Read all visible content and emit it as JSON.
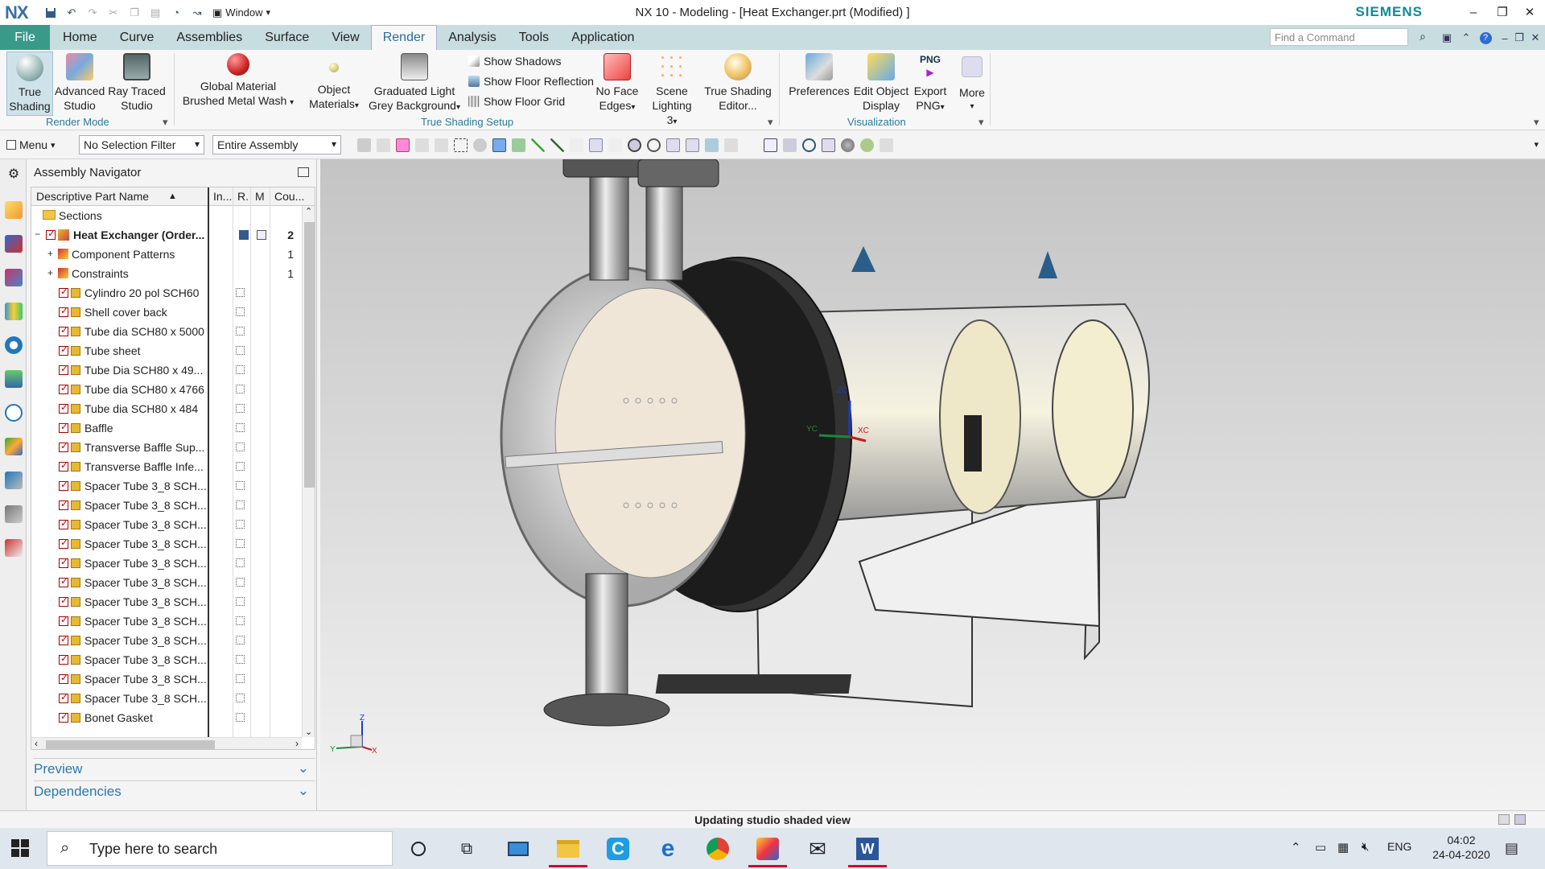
{
  "titlebar": {
    "app_logo": "NX",
    "window_menu": "Window",
    "title": "NX 10 - Modeling - [Heat Exchanger.prt (Modified) ]",
    "brand": "SIEMENS",
    "icons": [
      "save-icon",
      "undo-icon",
      "redo-icon",
      "cut-icon",
      "copy-icon",
      "paste-icon",
      "repeat-command-icon",
      "window-icon"
    ]
  },
  "tabs": {
    "file": "File",
    "items": [
      "Home",
      "Curve",
      "Assemblies",
      "Surface",
      "View",
      "Render",
      "Analysis",
      "Tools",
      "Application"
    ],
    "active": "Render",
    "find_placeholder": "Find a Command"
  },
  "ribbon": {
    "render_mode": {
      "label": "Render Mode",
      "true_shading": [
        "True",
        "Shading"
      ],
      "advanced_studio": [
        "Advanced",
        "Studio"
      ],
      "ray_traced_studio": [
        "Ray Traced",
        "Studio"
      ]
    },
    "true_shading_setup": {
      "label": "True Shading Setup",
      "global_material": [
        "Global Material",
        "Brushed Metal Wash"
      ],
      "object_materials": [
        "Object",
        "Materials"
      ],
      "graduated_light": [
        "Graduated Light",
        "Grey Background"
      ],
      "show_shadows": "Show Shadows",
      "show_floor_reflection": "Show Floor Reflection",
      "show_floor_grid": "Show Floor Grid",
      "no_face_edges": [
        "No Face",
        "Edges"
      ],
      "scene_lighting": [
        "Scene",
        "Lighting 3"
      ],
      "true_shading_editor": [
        "True Shading",
        "Editor..."
      ]
    },
    "visualization": {
      "label": "Visualization",
      "preferences": "Preferences",
      "edit_object_display": [
        "Edit Object",
        "Display"
      ],
      "export_png": [
        "Export",
        "PNG"
      ],
      "export_png_icon_text": "PNG",
      "more": "More"
    }
  },
  "toolbar": {
    "menu": "Menu",
    "selection_filter": "No Selection Filter",
    "scope": "Entire Assembly"
  },
  "navigator": {
    "title": "Assembly Navigator",
    "columns": [
      "Descriptive Part Name",
      "In...",
      "R.",
      "M",
      "Cou..."
    ],
    "rows": [
      {
        "name": "Sections",
        "type": "folder",
        "level": 0
      },
      {
        "name": "Heat Exchanger (Order...",
        "type": "assembly",
        "level": 0,
        "bold": true,
        "count": "2"
      },
      {
        "name": "Component Patterns",
        "type": "patterns",
        "level": 1,
        "count": "1"
      },
      {
        "name": "Constraints",
        "type": "constraints",
        "level": 1,
        "count": "1"
      },
      {
        "name": "Cylindro 20 pol SCH60",
        "type": "part",
        "level": 2
      },
      {
        "name": "Shell cover back",
        "type": "part",
        "level": 2
      },
      {
        "name": "Tube dia SCH80 x 5000",
        "type": "part",
        "level": 2
      },
      {
        "name": "Tube sheet",
        "type": "part",
        "level": 2
      },
      {
        "name": "Tube Dia SCH80 x 49...",
        "type": "part",
        "level": 2
      },
      {
        "name": "Tube dia SCH80 x 4766",
        "type": "part",
        "level": 2
      },
      {
        "name": "Tube dia SCH80 x 484",
        "type": "part",
        "level": 2
      },
      {
        "name": "Baffle",
        "type": "part",
        "level": 2
      },
      {
        "name": "Transverse Baffle Sup...",
        "type": "part",
        "level": 2
      },
      {
        "name": "Transverse Baffle Infe...",
        "type": "part",
        "level": 2
      },
      {
        "name": "Spacer Tube 3_8 SCH...",
        "type": "part",
        "level": 2
      },
      {
        "name": "Spacer Tube 3_8 SCH...",
        "type": "part",
        "level": 2
      },
      {
        "name": "Spacer Tube 3_8 SCH...",
        "type": "part",
        "level": 2
      },
      {
        "name": "Spacer Tube 3_8 SCH...",
        "type": "part",
        "level": 2
      },
      {
        "name": "Spacer Tube 3_8 SCH...",
        "type": "part",
        "level": 2
      },
      {
        "name": "Spacer Tube 3_8 SCH...",
        "type": "part",
        "level": 2
      },
      {
        "name": "Spacer Tube 3_8 SCH...",
        "type": "part",
        "level": 2
      },
      {
        "name": "Spacer Tube 3_8 SCH...",
        "type": "part",
        "level": 2
      },
      {
        "name": "Spacer Tube 3_8 SCH...",
        "type": "part",
        "level": 2
      },
      {
        "name": "Spacer Tube 3_8 SCH...",
        "type": "part",
        "level": 2
      },
      {
        "name": "Spacer Tube 3_8 SCH...",
        "type": "part",
        "level": 2
      },
      {
        "name": "Spacer Tube 3_8 SCH...",
        "type": "part",
        "level": 2
      },
      {
        "name": "Bonet Gasket",
        "type": "part",
        "level": 2
      }
    ],
    "preview": "Preview",
    "dependencies": "Dependencies"
  },
  "viewport": {
    "csys_labels": [
      "XC",
      "YC",
      "ZC"
    ],
    "triad_labels": [
      "X",
      "Y",
      "Z"
    ]
  },
  "status": "Updating studio shaded view",
  "taskbar": {
    "search_placeholder": "Type here to search",
    "apps": [
      "cortana-icon",
      "task-view-icon",
      "computer-icon",
      "file-explorer-icon",
      "ccleaner-icon",
      "edge-icon",
      "chrome-icon",
      "nx-icon",
      "mail-icon",
      "word-icon"
    ],
    "language": "ENG",
    "time": "04:02",
    "date": "24-04-2020"
  },
  "colors": {
    "accent_teal": "#3a9a8a",
    "tab_bar": "#c8dde0",
    "link_blue": "#2b7aa8",
    "brand_teal": "#0b8b9a"
  }
}
